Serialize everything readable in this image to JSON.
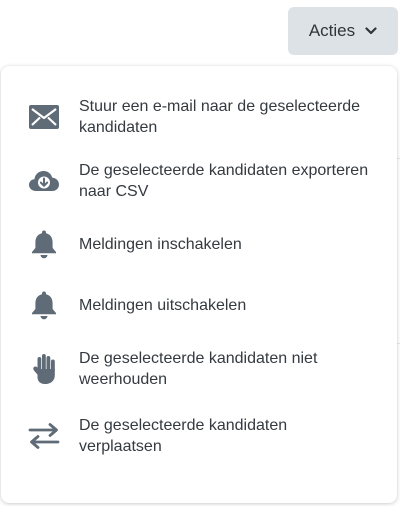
{
  "header": {
    "acties_label": "Acties",
    "acties_icon": "chevron-down-icon"
  },
  "menu": {
    "items": [
      {
        "label": "Stuur een e-mail naar de geselecteerde kandidaten",
        "icon": "envelope-icon"
      },
      {
        "label": "De geselecteerde kandidaten exporteren naar CSV",
        "icon": "cloud-download-icon"
      },
      {
        "label": "Meldingen inschakelen",
        "icon": "bell-icon"
      },
      {
        "label": "Meldingen uitschakelen",
        "icon": "bell-icon"
      },
      {
        "label": "De geselecteerde kandidaten niet weerhouden",
        "icon": "hand-icon"
      },
      {
        "label": "De geselecteerde kandidaten verplaatsen",
        "icon": "exchange-arrows-icon"
      }
    ]
  },
  "colors": {
    "button_bg": "#dde2e6",
    "text": "#343a40",
    "icon": "#5f6b76"
  }
}
